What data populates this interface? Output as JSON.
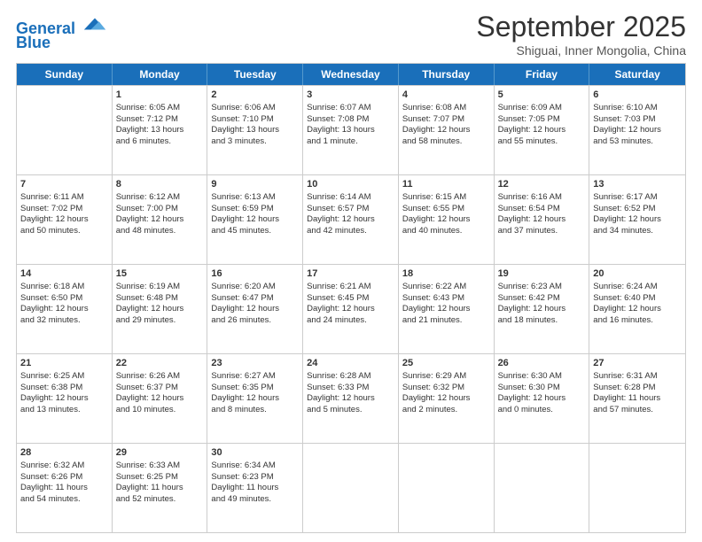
{
  "header": {
    "logo_line1": "General",
    "logo_line2": "Blue",
    "month": "September 2025",
    "location": "Shiguai, Inner Mongolia, China"
  },
  "days": [
    "Sunday",
    "Monday",
    "Tuesday",
    "Wednesday",
    "Thursday",
    "Friday",
    "Saturday"
  ],
  "rows": [
    [
      {
        "num": "",
        "lines": []
      },
      {
        "num": "1",
        "lines": [
          "Sunrise: 6:05 AM",
          "Sunset: 7:12 PM",
          "Daylight: 13 hours",
          "and 6 minutes."
        ]
      },
      {
        "num": "2",
        "lines": [
          "Sunrise: 6:06 AM",
          "Sunset: 7:10 PM",
          "Daylight: 13 hours",
          "and 3 minutes."
        ]
      },
      {
        "num": "3",
        "lines": [
          "Sunrise: 6:07 AM",
          "Sunset: 7:08 PM",
          "Daylight: 13 hours",
          "and 1 minute."
        ]
      },
      {
        "num": "4",
        "lines": [
          "Sunrise: 6:08 AM",
          "Sunset: 7:07 PM",
          "Daylight: 12 hours",
          "and 58 minutes."
        ]
      },
      {
        "num": "5",
        "lines": [
          "Sunrise: 6:09 AM",
          "Sunset: 7:05 PM",
          "Daylight: 12 hours",
          "and 55 minutes."
        ]
      },
      {
        "num": "6",
        "lines": [
          "Sunrise: 6:10 AM",
          "Sunset: 7:03 PM",
          "Daylight: 12 hours",
          "and 53 minutes."
        ]
      }
    ],
    [
      {
        "num": "7",
        "lines": [
          "Sunrise: 6:11 AM",
          "Sunset: 7:02 PM",
          "Daylight: 12 hours",
          "and 50 minutes."
        ]
      },
      {
        "num": "8",
        "lines": [
          "Sunrise: 6:12 AM",
          "Sunset: 7:00 PM",
          "Daylight: 12 hours",
          "and 48 minutes."
        ]
      },
      {
        "num": "9",
        "lines": [
          "Sunrise: 6:13 AM",
          "Sunset: 6:59 PM",
          "Daylight: 12 hours",
          "and 45 minutes."
        ]
      },
      {
        "num": "10",
        "lines": [
          "Sunrise: 6:14 AM",
          "Sunset: 6:57 PM",
          "Daylight: 12 hours",
          "and 42 minutes."
        ]
      },
      {
        "num": "11",
        "lines": [
          "Sunrise: 6:15 AM",
          "Sunset: 6:55 PM",
          "Daylight: 12 hours",
          "and 40 minutes."
        ]
      },
      {
        "num": "12",
        "lines": [
          "Sunrise: 6:16 AM",
          "Sunset: 6:54 PM",
          "Daylight: 12 hours",
          "and 37 minutes."
        ]
      },
      {
        "num": "13",
        "lines": [
          "Sunrise: 6:17 AM",
          "Sunset: 6:52 PM",
          "Daylight: 12 hours",
          "and 34 minutes."
        ]
      }
    ],
    [
      {
        "num": "14",
        "lines": [
          "Sunrise: 6:18 AM",
          "Sunset: 6:50 PM",
          "Daylight: 12 hours",
          "and 32 minutes."
        ]
      },
      {
        "num": "15",
        "lines": [
          "Sunrise: 6:19 AM",
          "Sunset: 6:48 PM",
          "Daylight: 12 hours",
          "and 29 minutes."
        ]
      },
      {
        "num": "16",
        "lines": [
          "Sunrise: 6:20 AM",
          "Sunset: 6:47 PM",
          "Daylight: 12 hours",
          "and 26 minutes."
        ]
      },
      {
        "num": "17",
        "lines": [
          "Sunrise: 6:21 AM",
          "Sunset: 6:45 PM",
          "Daylight: 12 hours",
          "and 24 minutes."
        ]
      },
      {
        "num": "18",
        "lines": [
          "Sunrise: 6:22 AM",
          "Sunset: 6:43 PM",
          "Daylight: 12 hours",
          "and 21 minutes."
        ]
      },
      {
        "num": "19",
        "lines": [
          "Sunrise: 6:23 AM",
          "Sunset: 6:42 PM",
          "Daylight: 12 hours",
          "and 18 minutes."
        ]
      },
      {
        "num": "20",
        "lines": [
          "Sunrise: 6:24 AM",
          "Sunset: 6:40 PM",
          "Daylight: 12 hours",
          "and 16 minutes."
        ]
      }
    ],
    [
      {
        "num": "21",
        "lines": [
          "Sunrise: 6:25 AM",
          "Sunset: 6:38 PM",
          "Daylight: 12 hours",
          "and 13 minutes."
        ]
      },
      {
        "num": "22",
        "lines": [
          "Sunrise: 6:26 AM",
          "Sunset: 6:37 PM",
          "Daylight: 12 hours",
          "and 10 minutes."
        ]
      },
      {
        "num": "23",
        "lines": [
          "Sunrise: 6:27 AM",
          "Sunset: 6:35 PM",
          "Daylight: 12 hours",
          "and 8 minutes."
        ]
      },
      {
        "num": "24",
        "lines": [
          "Sunrise: 6:28 AM",
          "Sunset: 6:33 PM",
          "Daylight: 12 hours",
          "and 5 minutes."
        ]
      },
      {
        "num": "25",
        "lines": [
          "Sunrise: 6:29 AM",
          "Sunset: 6:32 PM",
          "Daylight: 12 hours",
          "and 2 minutes."
        ]
      },
      {
        "num": "26",
        "lines": [
          "Sunrise: 6:30 AM",
          "Sunset: 6:30 PM",
          "Daylight: 12 hours",
          "and 0 minutes."
        ]
      },
      {
        "num": "27",
        "lines": [
          "Sunrise: 6:31 AM",
          "Sunset: 6:28 PM",
          "Daylight: 11 hours",
          "and 57 minutes."
        ]
      }
    ],
    [
      {
        "num": "28",
        "lines": [
          "Sunrise: 6:32 AM",
          "Sunset: 6:26 PM",
          "Daylight: 11 hours",
          "and 54 minutes."
        ]
      },
      {
        "num": "29",
        "lines": [
          "Sunrise: 6:33 AM",
          "Sunset: 6:25 PM",
          "Daylight: 11 hours",
          "and 52 minutes."
        ]
      },
      {
        "num": "30",
        "lines": [
          "Sunrise: 6:34 AM",
          "Sunset: 6:23 PM",
          "Daylight: 11 hours",
          "and 49 minutes."
        ]
      },
      {
        "num": "",
        "lines": []
      },
      {
        "num": "",
        "lines": []
      },
      {
        "num": "",
        "lines": []
      },
      {
        "num": "",
        "lines": []
      }
    ]
  ]
}
